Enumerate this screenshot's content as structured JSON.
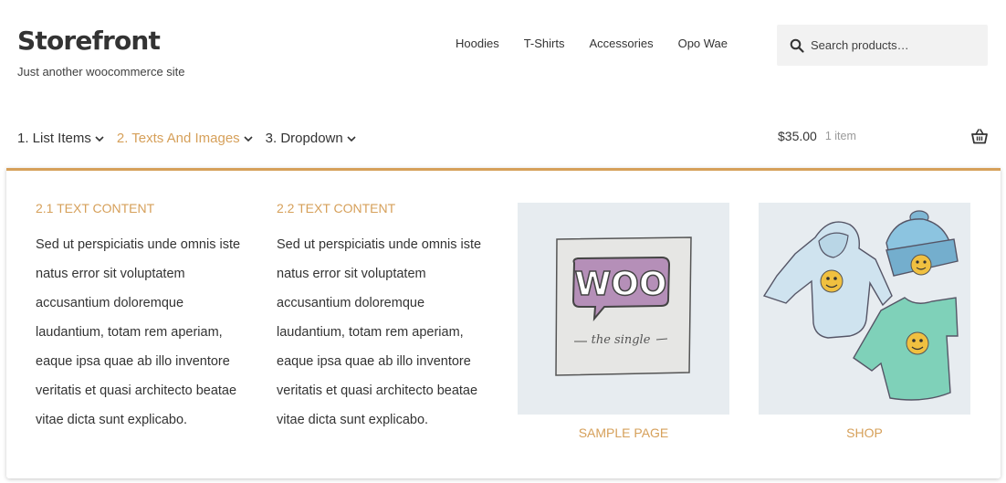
{
  "site": {
    "title": "Storefront",
    "tagline": "Just another woocommerce site"
  },
  "primary_nav": [
    {
      "label": "Hoodies"
    },
    {
      "label": "T-Shirts"
    },
    {
      "label": "Accessories"
    },
    {
      "label": "Opo Wae"
    }
  ],
  "search": {
    "placeholder": "Search products…",
    "icon": "search-icon"
  },
  "menu": [
    {
      "label": "1. List Items",
      "active": false
    },
    {
      "label": "2. Texts And Images",
      "active": true
    },
    {
      "label": "3. Dropdown",
      "active": false
    }
  ],
  "cart": {
    "amount": "$35.00",
    "count": "1 item",
    "icon": "basket-icon"
  },
  "mega_menu": {
    "columns": [
      {
        "heading": "2.1 Text Content",
        "body": "Sed ut perspiciatis unde omnis iste natus error sit voluptatem accusantium doloremque laudantium, totam rem aperiam, eaque ipsa quae ab illo inventore veritatis et quasi architecto beatae vitae dicta sunt explicabo."
      },
      {
        "heading": "2.2 Text Content",
        "body": "Sed ut perspiciatis unde omnis iste natus error sit voluptatem accusantium doloremque laudantium, totam rem aperiam, eaque ipsa quae ab illo inventore veritatis et quasi architecto beatae vitae dicta sunt explicabo."
      }
    ],
    "images": [
      {
        "caption": "Sample Page",
        "logo_text": "WOO",
        "subtitle": "the single"
      },
      {
        "caption": "Shop"
      }
    ]
  },
  "colors": {
    "accent": "#d6a05a",
    "text": "#333333",
    "search_bg": "#f2f2f2"
  }
}
